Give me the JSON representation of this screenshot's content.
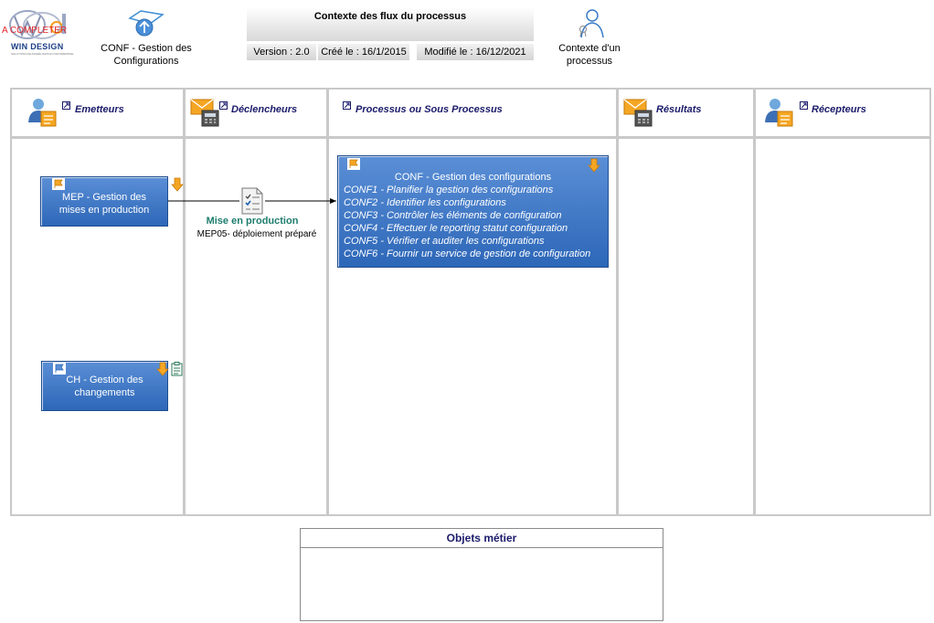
{
  "header": {
    "logo": {
      "name": "WIN DESIGN",
      "warning": "A COMPLETER",
      "tagline": "SOLUTIONS DE MODÉLISATION D'ENTREPRISE"
    },
    "parent_process": {
      "line1": "CONF - Gestion des",
      "line2": "Configurations"
    },
    "title": "Contexte des flux du processus",
    "version": "Version : 2.0",
    "created": "Créé le : 16/1/2015",
    "modified": "Modifié le : 16/12/2021",
    "context_link": {
      "line1": "Contexte d'un",
      "line2": "processus"
    }
  },
  "lanes": [
    {
      "title": "Emetteurs"
    },
    {
      "title": "Déclencheurs"
    },
    {
      "title": "Processus ou Sous Processus"
    },
    {
      "title": "Résultats"
    },
    {
      "title": "Récepteurs"
    }
  ],
  "nodes": {
    "mep": {
      "line1": "MEP - Gestion des",
      "line2": "mises en production"
    },
    "ch": {
      "line1": "CH - Gestion des",
      "line2": "changements"
    },
    "main": {
      "title": "CONF - Gestion des configurations",
      "items": [
        "CONF1 - Planifier la gestion des configurations",
        "CONF2 - Identifier les configurations",
        "CONF3 - Contrôler les éléments de configuration",
        "CONF4 - Effectuer le reporting  statut configuration",
        "CONF5 - Vérifier et auditer les configurations",
        "CONF6 - Fournir un service de gestion de configuration"
      ]
    },
    "trigger": {
      "title": "Mise en production",
      "subtitle": "MEP05- déploiement préparé"
    }
  },
  "objets": {
    "title": "Objets métier"
  },
  "colors": {
    "box_top": "#5b8fd6",
    "box_bottom": "#2d67b8",
    "lane_border": "#c9c9c9",
    "lane_title": "#1b1b6b",
    "trigger_title": "#1e7d6e"
  }
}
